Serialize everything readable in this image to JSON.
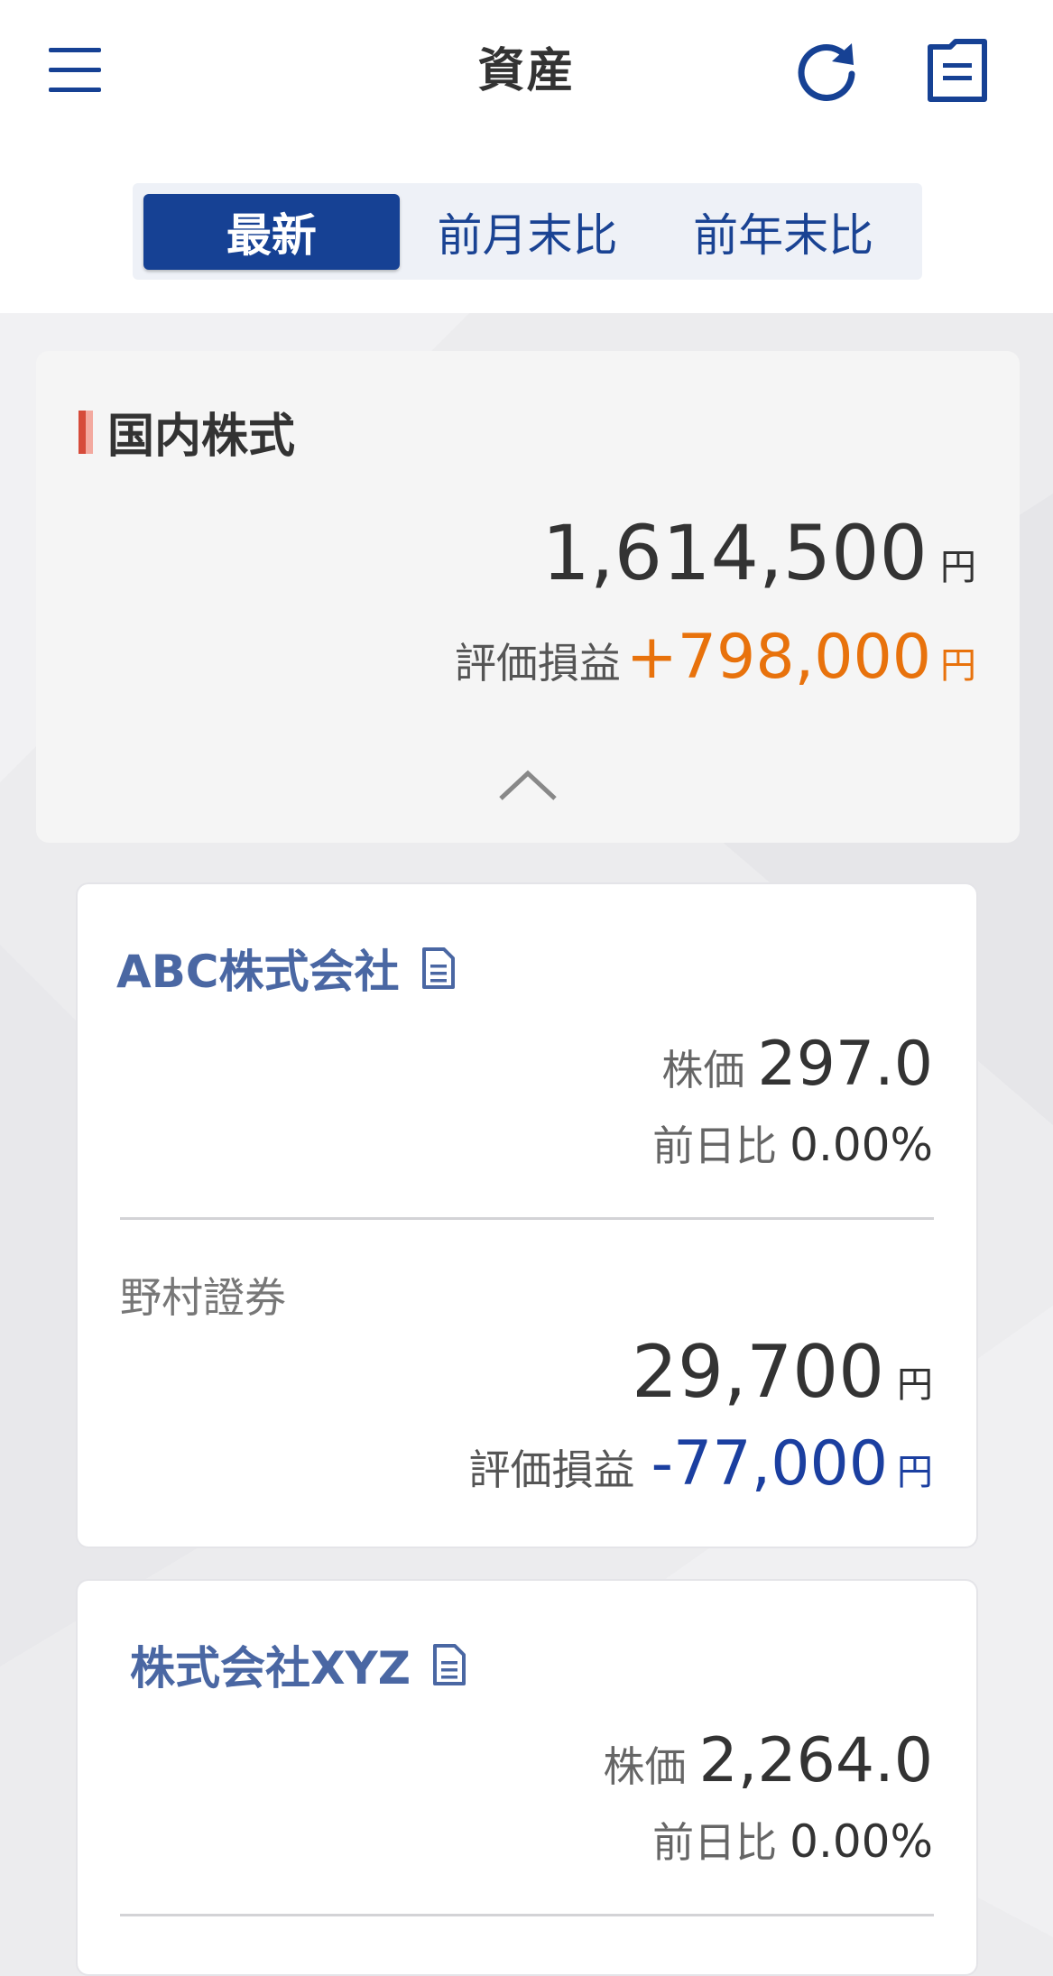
{
  "header": {
    "title": "資産",
    "menu_icon": "hamburger-menu-icon",
    "refresh_icon": "refresh-icon",
    "report_icon": "document-icon"
  },
  "tabs": [
    {
      "label": "最新",
      "active": true
    },
    {
      "label": "前月末比",
      "active": false
    },
    {
      "label": "前年末比",
      "active": false
    }
  ],
  "summary": {
    "section_title": "国内株式",
    "total_value": "1,614,500",
    "currency": "円",
    "pl_label": "評価損益",
    "pl_value": "+798,000",
    "collapse_icon": "chevron-up-icon"
  },
  "holdings": [
    {
      "name": "ABC株式会社",
      "price_label": "株価",
      "price": "297.0",
      "change_label": "前日比",
      "change": "0.00%",
      "broker": "野村證券",
      "value": "29,700",
      "currency": "円",
      "pl_label": "評価損益",
      "pl_value": "-77,000"
    },
    {
      "name": "株式会社XYZ",
      "price_label": "株価",
      "price": "2,264.0",
      "change_label": "前日比",
      "change": "0.00%"
    }
  ],
  "colors": {
    "primary": "#164194",
    "gain": "#e8720c",
    "loss": "#1b3fa0",
    "link": "#4a67a3"
  }
}
